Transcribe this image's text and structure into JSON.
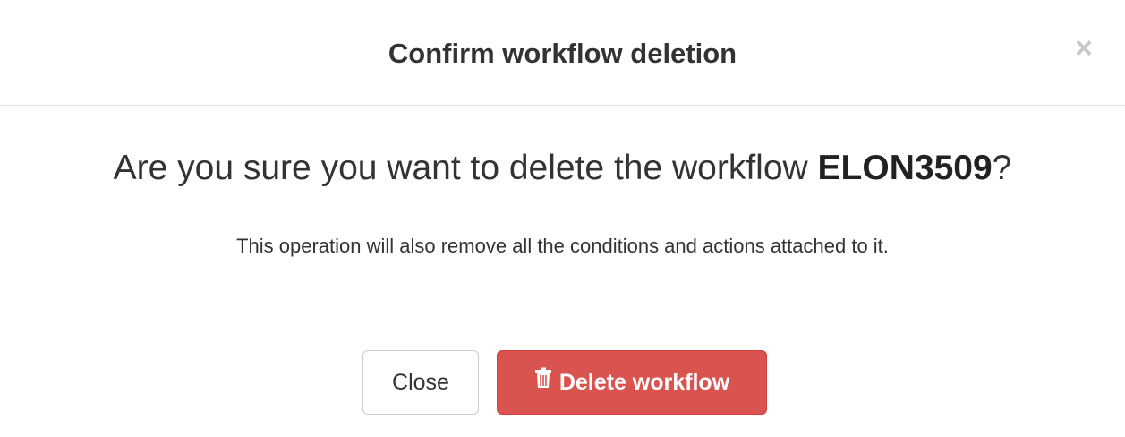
{
  "dialog": {
    "title": "Confirm workflow deletion",
    "close_symbol": "×",
    "question_prefix": "Are you sure you want to delete the workflow ",
    "workflow_name": "ELON3509",
    "question_suffix": "?",
    "note": "This operation will also remove all the conditions and actions attached to it."
  },
  "footer": {
    "close_label": "Close",
    "delete_label": "Delete workflow",
    "delete_icon": "trash-icon"
  },
  "colors": {
    "danger": "#d9534f",
    "close_x": "#c8c8c8",
    "divider": "#e5e5e5"
  }
}
